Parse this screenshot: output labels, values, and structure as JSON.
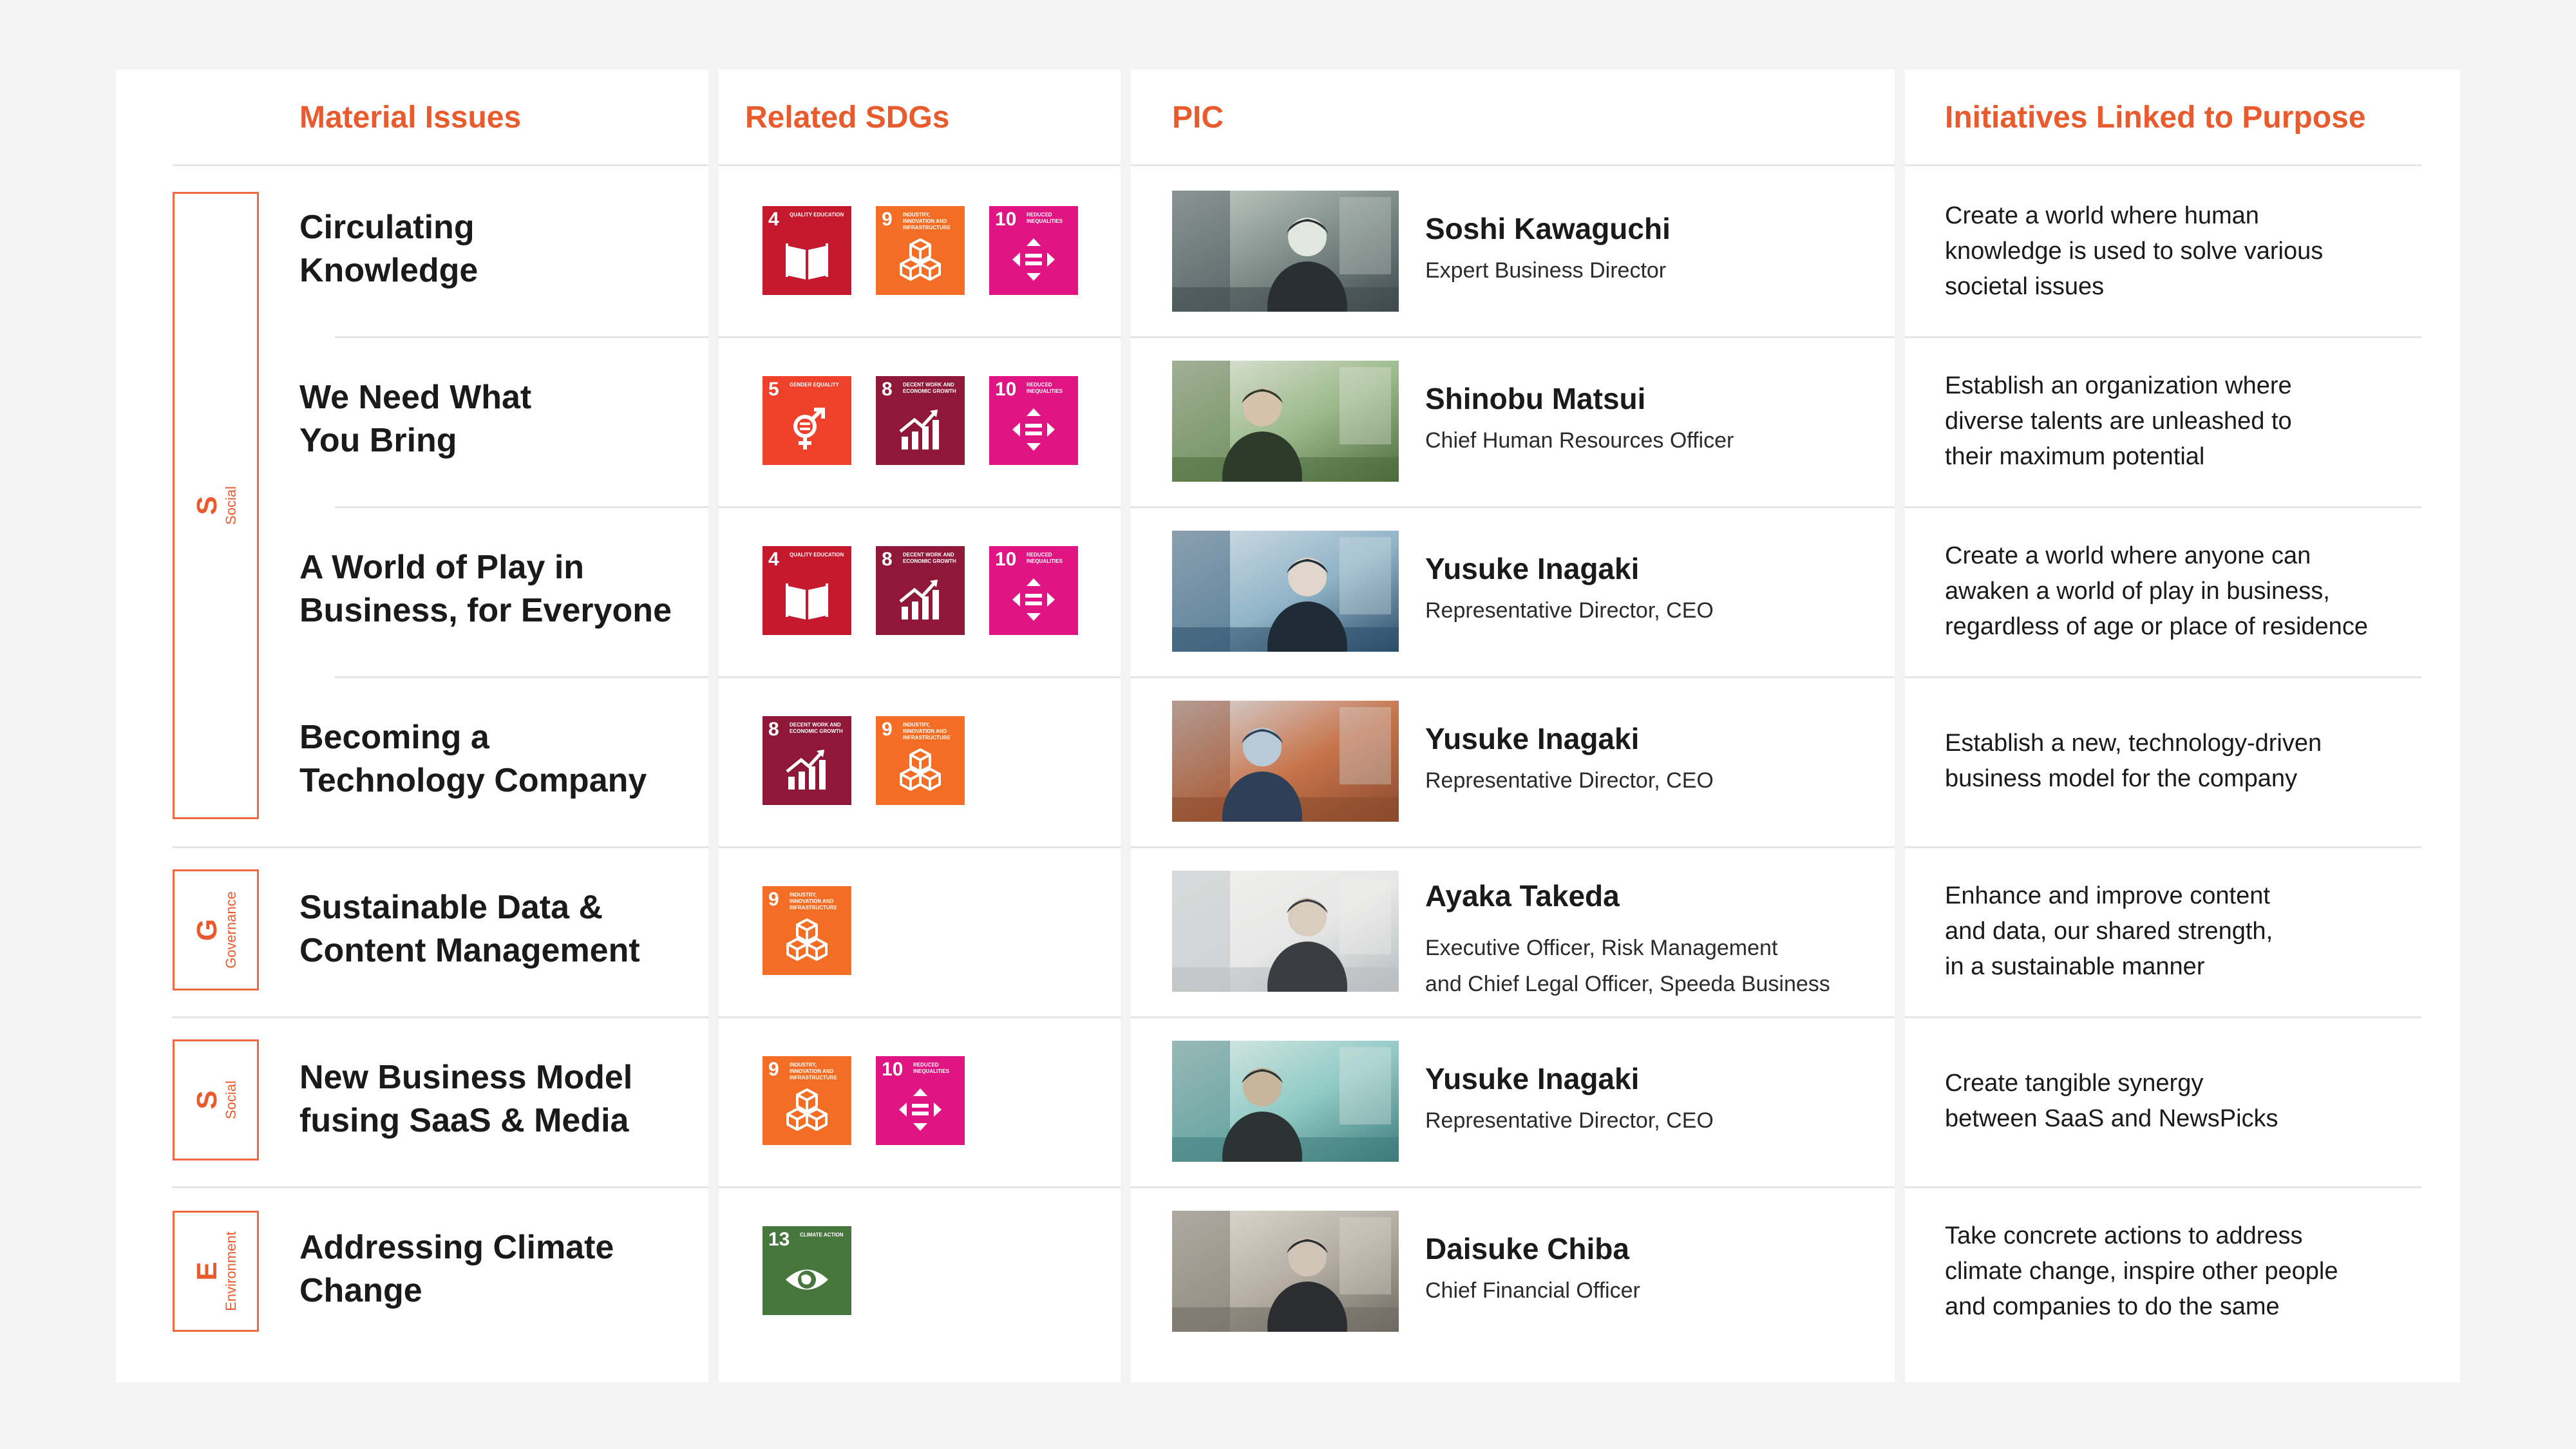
{
  "headers": {
    "material_issues": "Material Issues",
    "related_sdgs": "Related SDGs",
    "pic": "PIC",
    "initiatives": "Initiatives Linked to Purpose"
  },
  "categories": [
    {
      "letter": "S",
      "word": "Social"
    },
    {
      "letter": "G",
      "word": "Governance"
    },
    {
      "letter": "S",
      "word": "Social"
    },
    {
      "letter": "E",
      "word": "Environment"
    }
  ],
  "sdg_goals": {
    "g4": {
      "number": "4",
      "label": "Quality Education",
      "color": "#c5192d",
      "icon": "book-icon"
    },
    "g5": {
      "number": "5",
      "label": "Gender Equality",
      "color": "#ef402b",
      "icon": "gender-equality-icon"
    },
    "g8": {
      "number": "8",
      "label": "Decent Work and Economic Growth",
      "color": "#8f1838",
      "icon": "growth-chart-icon"
    },
    "g9": {
      "number": "9",
      "label": "Industry, Innovation and Infrastructure",
      "color": "#f36d25",
      "icon": "cubes-icon"
    },
    "g10": {
      "number": "10",
      "label": "Reduced Inequalities",
      "color": "#e11484",
      "icon": "equality-arrows-icon"
    },
    "g13": {
      "number": "13",
      "label": "Climate Action",
      "color": "#48773e",
      "icon": "eye-globe-icon"
    }
  },
  "rows": [
    {
      "issue": [
        "Circulating",
        "Knowledge"
      ],
      "sdgs": [
        "g4",
        "g9",
        "g10"
      ],
      "pic_name": "Soshi Kawaguchi",
      "pic_title": [
        "Expert Business Director"
      ],
      "initiative": [
        "Create a world where human",
        "knowledge is used to solve various",
        "societal issues"
      ]
    },
    {
      "issue": [
        "We Need What",
        "You Bring"
      ],
      "sdgs": [
        "g5",
        "g8",
        "g10"
      ],
      "pic_name": "Shinobu Matsui",
      "pic_title": [
        "Chief Human Resources Officer"
      ],
      "initiative": [
        "Establish an organization where",
        "diverse talents are unleashed to",
        "their maximum potential"
      ]
    },
    {
      "issue": [
        "A World of Play in",
        "Business, for Everyone"
      ],
      "sdgs": [
        "g4",
        "g8",
        "g10"
      ],
      "pic_name": "Yusuke Inagaki",
      "pic_title": [
        "Representative Director, CEO"
      ],
      "initiative": [
        "Create a world where anyone can",
        "awaken a world of play in business,",
        "regardless of age or place of residence"
      ]
    },
    {
      "issue": [
        "Becoming a",
        "Technology Company"
      ],
      "sdgs": [
        "g8",
        "g9"
      ],
      "pic_name": "Yusuke Inagaki",
      "pic_title": [
        "Representative Director, CEO"
      ],
      "initiative": [
        "Establish a new, technology-driven",
        "business model for the company"
      ]
    },
    {
      "issue": [
        "Sustainable Data &",
        "Content Management"
      ],
      "sdgs": [
        "g9"
      ],
      "pic_name": "Ayaka Takeda",
      "pic_title": [
        "Executive Officer, Risk Management",
        "and Chief Legal Officer, Speeda Business"
      ],
      "initiative": [
        "Enhance and improve content",
        "and data, our shared strength,",
        "in a sustainable manner"
      ]
    },
    {
      "issue": [
        "New Business Model",
        "fusing SaaS & Media"
      ],
      "sdgs": [
        "g9",
        "g10"
      ],
      "pic_name": "Yusuke Inagaki",
      "pic_title": [
        "Representative Director, CEO"
      ],
      "initiative": [
        "Create tangible synergy",
        "between SaaS and NewsPicks"
      ]
    },
    {
      "issue": [
        "Addressing Climate",
        "Change"
      ],
      "sdgs": [
        "g13"
      ],
      "pic_name": "Daisuke Chiba",
      "pic_title": [
        "Chief Financial Officer"
      ],
      "initiative": [
        "Take concrete actions to address",
        "climate change, inspire other people",
        "and companies to do the same"
      ]
    }
  ]
}
